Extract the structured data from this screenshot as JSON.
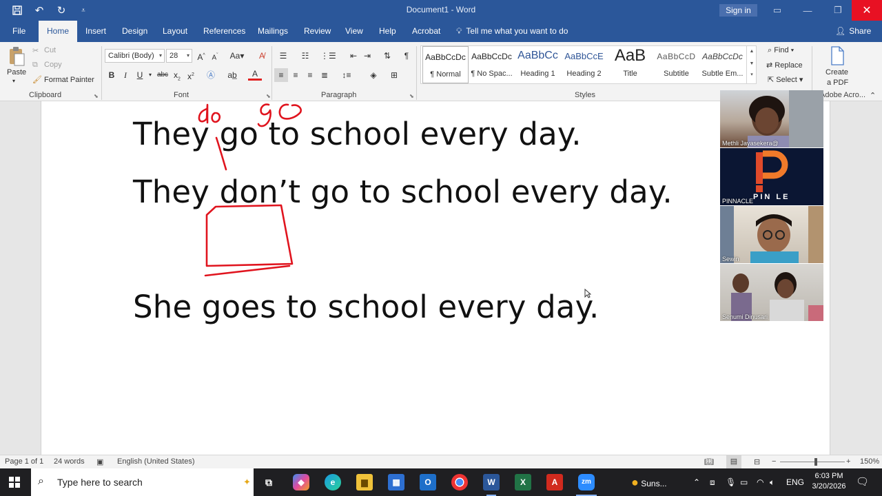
{
  "window": {
    "title": "Document1 - Word",
    "sign_in": "Sign in"
  },
  "menu": {
    "tabs": [
      "File",
      "Home",
      "Insert",
      "Design",
      "Layout",
      "References",
      "Mailings",
      "Review",
      "View",
      "Help",
      "Acrobat"
    ],
    "active": "Home",
    "tell_me": "Tell me what you want to do",
    "share": "Share"
  },
  "ribbon": {
    "clipboard": {
      "label": "Clipboard",
      "paste": "Paste",
      "cut": "Cut",
      "copy": "Copy",
      "format_painter": "Format Painter"
    },
    "font": {
      "label": "Font",
      "family": "Calibri (Body)",
      "size": "28"
    },
    "paragraph": {
      "label": "Paragraph"
    },
    "styles": {
      "label": "Styles",
      "items": [
        {
          "preview": "AaBbCcDc",
          "name": "¶ Normal"
        },
        {
          "preview": "AaBbCcDc",
          "name": "¶ No Spac..."
        },
        {
          "preview": "AaBbCc",
          "name": "Heading 1"
        },
        {
          "preview": "AaBbCcE",
          "name": "Heading 2"
        },
        {
          "preview": "AaB",
          "name": "Title"
        },
        {
          "preview": "AaBbCcD",
          "name": "Subtitle"
        },
        {
          "preview": "AaBbCcDc",
          "name": "Subtle Em..."
        }
      ]
    },
    "editing": {
      "find": "Find",
      "replace": "Replace",
      "select": "Select"
    },
    "acrobat": {
      "create_pdf_line1": "Create",
      "create_pdf_line2": "a PDF",
      "label": "Adobe Acro..."
    }
  },
  "document": {
    "lines": [
      "They go to school every day.",
      "They don’t go to school every day.",
      "She goes to school every day."
    ],
    "ink_annotations": [
      "do",
      "go"
    ]
  },
  "participants": [
    {
      "name": "Methli  Jayasekera@"
    },
    {
      "name": "PINNACLE",
      "logo_text": "PIN  LE"
    },
    {
      "name": "Sewin"
    },
    {
      "name": "Senumi Dinusari"
    }
  ],
  "status": {
    "page": "Page 1 of 1",
    "words": "24 words",
    "language": "English (United States)",
    "zoom": "150%"
  },
  "taskbar": {
    "search_placeholder": "Type here to search",
    "weather": "Suns...",
    "lang": "ENG",
    "time": "6:03 PM",
    "date": "3/20/2026"
  },
  "colors": {
    "word_blue": "#2b579a",
    "ink_red": "#e0141e"
  }
}
